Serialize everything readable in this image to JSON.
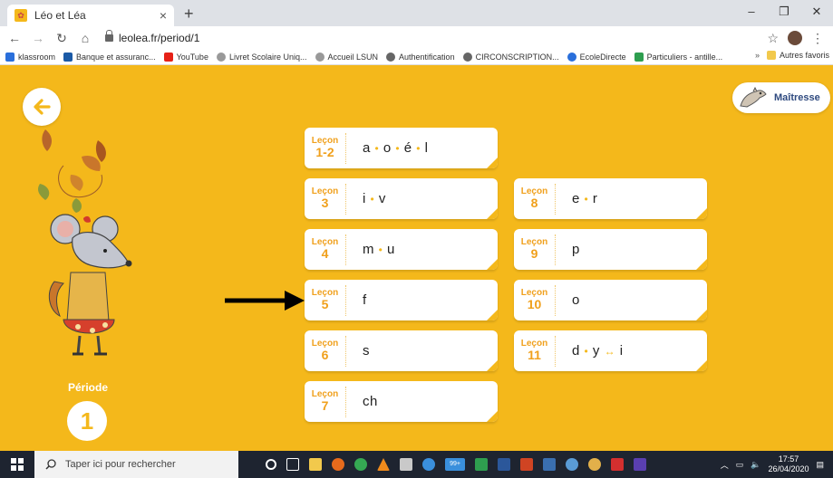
{
  "browser": {
    "tab_title": "Léo et Léa",
    "tab_close": "×",
    "new_tab": "+",
    "url": "leolea.fr/period/1",
    "bookmarks": [
      {
        "label": "klassroom",
        "color": "#2a6fdb"
      },
      {
        "label": "Banque et assuranc...",
        "color": "#1b5aa6"
      },
      {
        "label": "YouTube",
        "color": "#e62117"
      },
      {
        "label": "Livret Scolaire Uniq...",
        "color": "#888888"
      },
      {
        "label": "Accueil LSUN",
        "color": "#888888"
      },
      {
        "label": "Authentification",
        "color": "#666666"
      },
      {
        "label": "CIRCONSCRIPTION...",
        "color": "#666666"
      },
      {
        "label": "EcoleDirecte",
        "color": "#2a6fdb"
      },
      {
        "label": "Particuliers - antille...",
        "color": "#2e9e4f"
      }
    ],
    "bookmarks_more": "»",
    "other_bookmarks": "Autres favoris"
  },
  "app": {
    "teacher_button": "Maîtresse",
    "period_label": "Période",
    "period_number": "1",
    "lesson_word": "Leçon",
    "lessons": [
      {
        "number": "1-2",
        "letters": "a • o • é • l"
      },
      {
        "number": "3",
        "letters": "i • v"
      },
      {
        "number": "4",
        "letters": "m • u"
      },
      {
        "number": "5",
        "letters": "f"
      },
      {
        "number": "6",
        "letters": "s"
      },
      {
        "number": "7",
        "letters": "ch"
      },
      {
        "number": "8",
        "letters": "e • r"
      },
      {
        "number": "9",
        "letters": "p"
      },
      {
        "number": "10",
        "letters": "o"
      },
      {
        "number": "11",
        "letters": "d • y ↔ i"
      }
    ],
    "colors": {
      "background": "#f4b81b",
      "lesson_label": "#f0a01c",
      "teacher_text": "#2f4a7f"
    }
  },
  "taskbar": {
    "search_placeholder": "Taper ici pour rechercher",
    "time": "17:57",
    "date": "26/04/2020",
    "badge": "99+"
  }
}
